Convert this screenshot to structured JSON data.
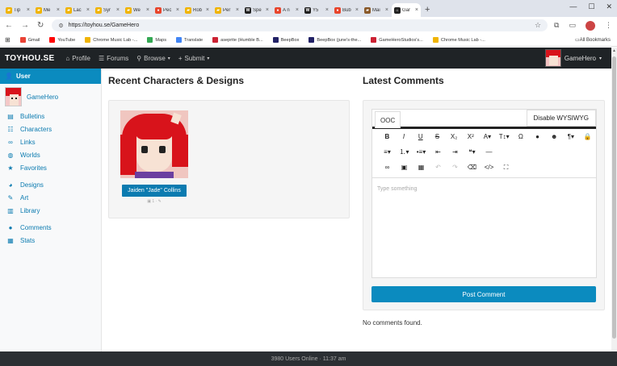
{
  "browser": {
    "tabs": [
      {
        "label": "Tip",
        "color": "#f0b400",
        "glyph": "▰"
      },
      {
        "label": "Me",
        "color": "#f0b400",
        "glyph": "▰"
      },
      {
        "label": "Lac",
        "color": "#f0b400",
        "glyph": "▰"
      },
      {
        "label": "Syr",
        "color": "#f0b400",
        "glyph": "▰"
      },
      {
        "label": "We",
        "color": "#f0b400",
        "glyph": "▰"
      },
      {
        "label": "Pec",
        "color": "#e8452c",
        "glyph": "●"
      },
      {
        "label": "Rob",
        "color": "#f0b400",
        "glyph": "▰"
      },
      {
        "label": "Per",
        "color": "#f0b400",
        "glyph": "▰"
      },
      {
        "label": "Spe",
        "color": "#222222",
        "glyph": "W"
      },
      {
        "label": "A n",
        "color": "#e8452c",
        "glyph": "●"
      },
      {
        "label": "Y5",
        "color": "#222222",
        "glyph": "W"
      },
      {
        "label": "Bub",
        "color": "#e8452c",
        "glyph": "●"
      },
      {
        "label": "Mai",
        "color": "#8a5a2a",
        "glyph": "▰"
      },
      {
        "label": "Gar",
        "color": "#222222",
        "glyph": "⌂",
        "active": true
      }
    ],
    "url": "https://toyhou.se/GameHero",
    "bookmarks": [
      {
        "label": "Gmail",
        "color": "#ea4335"
      },
      {
        "label": "YouTube",
        "color": "#ff0000"
      },
      {
        "label": "Chrome Music Lab -...",
        "color": "#f0b400"
      },
      {
        "label": "Maps",
        "color": "#34a853"
      },
      {
        "label": "Translate",
        "color": "#4285f4"
      },
      {
        "label": "aseprite (Humble B...",
        "color": "#cc2233"
      },
      {
        "label": "BeepBox",
        "color": "#222266"
      },
      {
        "label": "BeepBox (june's-the...",
        "color": "#222266"
      },
      {
        "label": "GameHeroStudios's...",
        "color": "#cc2233"
      },
      {
        "label": "Chrome Music Lab -...",
        "color": "#f0b400"
      }
    ],
    "all_bookmarks": "All Bookmarks"
  },
  "nav": {
    "logo": "TOYHOU.SE",
    "links": [
      {
        "label": "Profile",
        "icon": "⌂"
      },
      {
        "label": "Forums",
        "icon": "☰"
      },
      {
        "label": "Browse",
        "icon": "⚲",
        "caret": true
      },
      {
        "label": "Submit",
        "icon": "+",
        "caret": true
      }
    ],
    "username": "GameHero"
  },
  "sidebar": {
    "header": "User",
    "username": "GameHero",
    "groups": [
      [
        {
          "label": "Bulletins",
          "icon": "▤"
        },
        {
          "label": "Characters",
          "icon": "☷"
        },
        {
          "label": "Links",
          "icon": "∞"
        },
        {
          "label": "Worlds",
          "icon": "◍"
        },
        {
          "label": "Favorites",
          "icon": "★"
        }
      ],
      [
        {
          "label": "Designs",
          "icon": "◕"
        },
        {
          "label": "Art",
          "icon": "✎"
        },
        {
          "label": "Library",
          "icon": "▥"
        }
      ],
      [
        {
          "label": "Comments",
          "icon": "●"
        },
        {
          "label": "Stats",
          "icon": "▦"
        }
      ]
    ]
  },
  "main": {
    "recent_title": "Recent Characters & Designs",
    "character_name": "Jaiden \"Jade\" Collins",
    "comments_title": "Latest Comments",
    "editor_tab": "OOC",
    "disable_wysiwyg": "Disable WYSIWYG",
    "placeholder": "Type something",
    "post_button": "Post Comment",
    "no_comments": "No comments found."
  },
  "footer": {
    "text": "3980 Users Online · 11:37 am"
  }
}
